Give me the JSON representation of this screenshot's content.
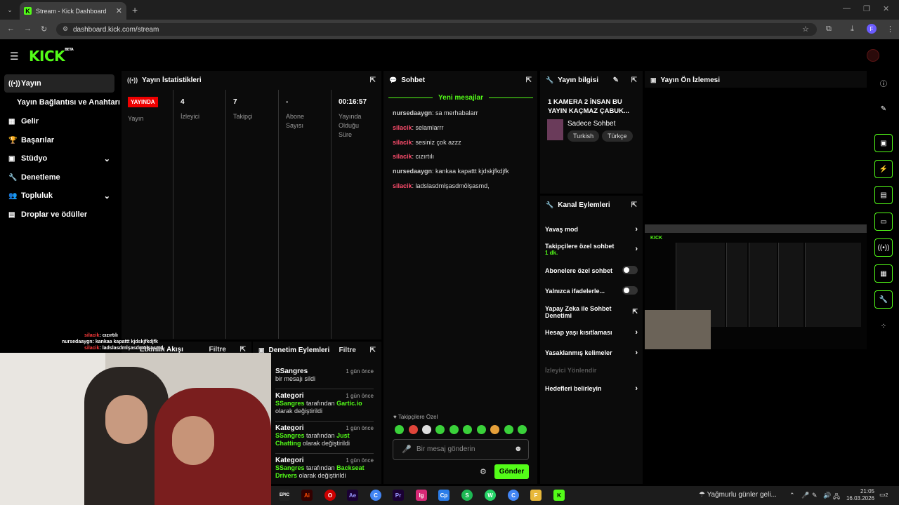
{
  "browser": {
    "tab_title": "Stream - Kick Dashboard",
    "tab_close": "✕",
    "new_tab": "+",
    "url": "dashboard.kick.com/stream",
    "profile_initial": "F"
  },
  "app": {
    "logo": "KICK",
    "logo_badge": "BETA"
  },
  "sidebar": {
    "items": [
      {
        "label": "Yayın",
        "icon": "broadcast-icon"
      },
      {
        "label": "Yayın Bağlantısı ve Anahtarı"
      },
      {
        "label": "Gelir",
        "icon": "revenue-icon"
      },
      {
        "label": "Başarılar",
        "icon": "trophy-icon"
      },
      {
        "label": "Stüdyo",
        "icon": "studio-icon"
      },
      {
        "label": "Denetleme",
        "icon": "wrench-icon"
      },
      {
        "label": "Topluluk",
        "icon": "community-icon"
      },
      {
        "label": "Droplar ve ödüller",
        "icon": "drops-icon"
      }
    ]
  },
  "stats": {
    "title": "Yayın İstatistikleri",
    "live_badge": "YAYINDA",
    "live_label": "Yayın",
    "cols": [
      {
        "value": "4",
        "label": "İzleyici"
      },
      {
        "value": "7",
        "label": "Takipçi"
      },
      {
        "value": "-",
        "label": "Abone Sayısı"
      },
      {
        "value": "00:16:57",
        "label": "Yayında Olduğu Süre"
      }
    ]
  },
  "chat": {
    "title": "Sohbet",
    "new_messages": "Yeni mesajlar",
    "messages": [
      {
        "user": "nursedaaygn",
        "color": "#cfcfcf",
        "text": "sa merhabalarr"
      },
      {
        "user": "silacik",
        "color": "#ff4d6d",
        "text": "selamlarrr"
      },
      {
        "user": "silacik",
        "color": "#ff4d6d",
        "text": "sesiniz çok azzz"
      },
      {
        "user": "silacik",
        "color": "#ff4d6d",
        "text": "cızırtılı"
      },
      {
        "user": "nursedaaygn",
        "color": "#cfcfcf",
        "text": "kankaa kapattt kjdskjfkdjfk"
      },
      {
        "user": "silacik",
        "color": "#ff4d6d",
        "text": "ladslasdmlşasdmölşasmd,"
      }
    ],
    "followers_only": "Takipçilere Özel",
    "input_placeholder": "Bir mesaj gönderin",
    "send": "Gönder"
  },
  "stream_info": {
    "title": "Yayın bilgisi",
    "stream_title": "1 KAMERA 2 İNSAN BU YAYIN KAÇMAZ ÇABUK...",
    "category": "Sadece Sohbet",
    "tags": [
      "Turkish",
      "Türkçe"
    ]
  },
  "preview": {
    "title": "Yayın Ön İzlemesi"
  },
  "channel_actions": {
    "title": "Kanal Eylemleri",
    "items": [
      {
        "label": "Yavaş mod",
        "type": "arrow"
      },
      {
        "label": "Takipçilere özel sohbet",
        "sub": "1 dk.",
        "type": "arrow"
      },
      {
        "label": "Abonelere özel sohbet",
        "type": "toggle"
      },
      {
        "label": "Yalnızca ifadelerle...",
        "type": "toggle"
      },
      {
        "label": "Yapay Zeka ile Sohbet Denetimi",
        "type": "external"
      },
      {
        "label": "Hesap yaşı kısıtlaması",
        "type": "arrow"
      },
      {
        "label": "Yasaklanmış kelimeler",
        "type": "arrow"
      },
      {
        "label": "İzleyici Yönlendir",
        "type": "disabled"
      },
      {
        "label": "Hedefleri belirleyin",
        "type": "arrow"
      }
    ]
  },
  "activity": {
    "title": "Etkinlik Akışı",
    "filter": "Filtre"
  },
  "mod_actions": {
    "title": "Denetim Eylemleri",
    "filter": "Filtre",
    "items": [
      {
        "name": "SSangres",
        "time": "1 gün önce",
        "desc": "bir mesajı sildi"
      },
      {
        "name": "Kategori",
        "time": "1 gün önce",
        "by": "SSangres",
        "mid": " tarafından ",
        "target": "Gartic.io",
        "end": " olarak değiştirildi"
      },
      {
        "name": "Kategori",
        "time": "1 gün önce",
        "by": "SSangres",
        "mid": " tarafından ",
        "target": "Just Chatting",
        "end": " olarak değiştirildi"
      },
      {
        "name": "Kategori",
        "time": "1 gün önce",
        "by": "SSangres",
        "mid": " tarafından ",
        "target": "Backseat Drivers",
        "end": " olarak değiştirildi"
      }
    ]
  },
  "overlay_chat": [
    {
      "user": "silacik",
      "text": ": cızırtılı"
    },
    {
      "user": "nursedaaygn",
      "text": ": kankaa kapattt kjdskjfkdjfk"
    },
    {
      "user": "silacik",
      "text": ": ladslasdmlşasdmölşasmd,"
    }
  ],
  "taskbar": {
    "weather": "Yağmurlu günler geli...",
    "time": "21:05",
    "date": "16.03.2026",
    "notif_count": "2",
    "apps": [
      "EPIC",
      "Ai",
      "O",
      "Ae",
      "C",
      "Pr",
      "Ig",
      "Cp",
      "S",
      "W",
      "C",
      "F",
      "K"
    ]
  },
  "colors": {
    "accent": "#53fc18",
    "live": "#ee0000",
    "user_red": "#ff4d6d"
  }
}
